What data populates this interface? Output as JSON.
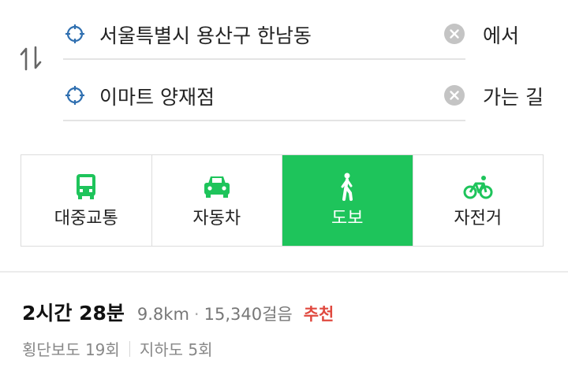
{
  "route": {
    "origin": {
      "value": "서울특별시 용산구 한남동",
      "suffix": "에서"
    },
    "destination": {
      "value": "이마트 양재점",
      "suffix": "가는 길"
    }
  },
  "modes": [
    {
      "label": "대중교통",
      "icon": "bus-icon"
    },
    {
      "label": "자동차",
      "icon": "car-icon"
    },
    {
      "label": "도보",
      "icon": "walk-icon",
      "active": true
    },
    {
      "label": "자전거",
      "icon": "bicycle-icon"
    }
  ],
  "result": {
    "duration": "2시간 28분",
    "distance": "9.8km",
    "separator": "·",
    "steps": "15,340걸음",
    "badge": "추천",
    "crosswalks": "횡단보도 19회",
    "underpasses": "지하도 5회"
  },
  "colors": {
    "accent_green": "#1ec45b",
    "target_blue": "#2f6fb0",
    "badge_red": "#e0493f"
  }
}
